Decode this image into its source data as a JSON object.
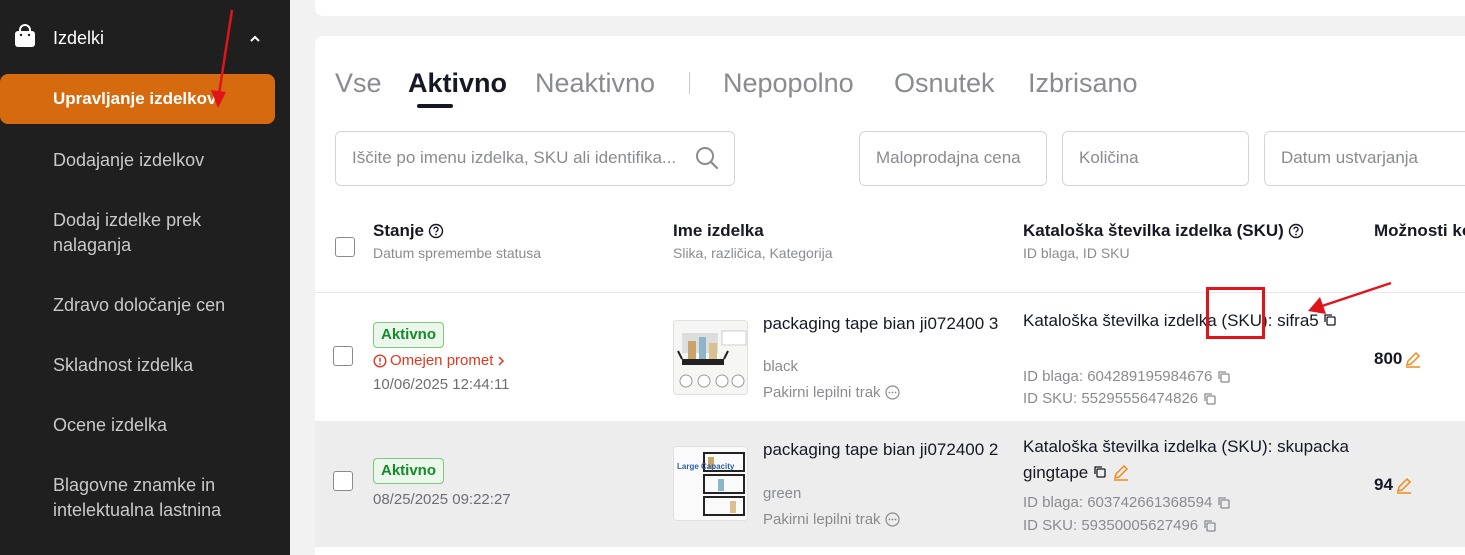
{
  "sidebar": {
    "section_label": "Izdelki",
    "items": [
      {
        "label": "Upravljanje izdelkov",
        "active": true
      },
      {
        "label": "Dodajanje izdelkov"
      },
      {
        "label": "Dodaj izdelke prek nalaganja"
      },
      {
        "label": "Zdravo določanje cen"
      },
      {
        "label": "Skladnost izdelka"
      },
      {
        "label": "Ocene izdelka"
      },
      {
        "label": "Blagovne znamke in intelektualna lastnina"
      }
    ]
  },
  "tabs": [
    "Vse",
    "Aktivno",
    "Neaktivno",
    "Nepopolno",
    "Osnutek",
    "Izbrisano"
  ],
  "active_tab": "Aktivno",
  "filters": {
    "search_placeholder": "Iščite po imenu izdelka, SKU ali identifika...",
    "price_placeholder": "Maloprodajna cena",
    "quantity_placeholder": "Količina",
    "date_placeholder": "Datum ustvarjanja"
  },
  "table": {
    "headers": [
      {
        "title": "Stanje",
        "sub": "Datum spremembe statusa"
      },
      {
        "title": "Ime izdelka",
        "sub": "Slika, različica, Kategorija"
      },
      {
        "title": "Kataloška številka izdelka (SKU)",
        "sub": "ID blaga, ID SKU"
      },
      {
        "title": "Možnosti ko"
      }
    ],
    "rows": [
      {
        "status": "Aktivno",
        "warning": "Omejen promet",
        "date": "10/06/2025 12:44:11",
        "name": "packaging tape bian ji072400 3",
        "variant": "black",
        "category": "Pakirni lepilni trak",
        "sku": "Kataloška številka izdelka (SKU): sifra5",
        "goods_id": "ID blaga: 604289195984676",
        "sku_id": "ID SKU: 55295556474826",
        "quantity": "800"
      },
      {
        "status": "Aktivno",
        "date": "08/25/2025 09:22:27",
        "name": "packaging tape bian ji072400 2",
        "variant": "green",
        "category": "Pakirni lepilni trak",
        "sku": "Kataloška številka izdelka (SKU): skupacka gingtape",
        "goods_id": "ID blaga: 603742661368594",
        "sku_id": "ID SKU: 59350005627496",
        "quantity": "94",
        "thumb_text": "Large Capacity"
      }
    ]
  },
  "colors": {
    "sidebar_bg": "#1f1f1f",
    "sidebar_active": "#d66a0e",
    "status_green": "#168b2b",
    "warning_red": "#e2361d",
    "edit_orange": "#f08a17",
    "annotation_red": "#e0151b"
  }
}
